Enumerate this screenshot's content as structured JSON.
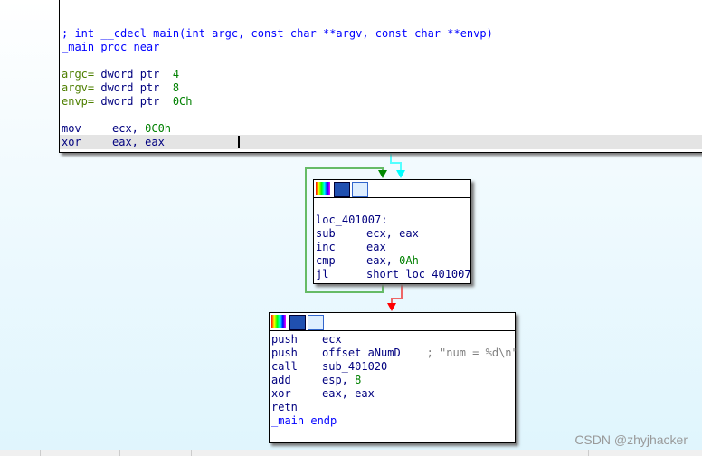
{
  "top_block": {
    "signature": "; int __cdecl main(int argc, const char **argv, const char **envp)",
    "proc": "_main proc near",
    "args": [
      {
        "name": "argc=",
        "type": " dword ptr  ",
        "val": "4"
      },
      {
        "name": "argv=",
        "type": " dword ptr  ",
        "val": "8"
      },
      {
        "name": "envp=",
        "type": " dword ptr  ",
        "val": "0Ch"
      }
    ],
    "ins": [
      {
        "op": "mov",
        "a": "ecx, ",
        "imm": "0C0h"
      },
      {
        "op": "xor",
        "a": "eax, eax",
        "imm": ""
      }
    ]
  },
  "loop_block": {
    "label": "loc_401007:",
    "ins": [
      {
        "op": "sub",
        "a": "ecx, eax",
        "imm": ""
      },
      {
        "op": "inc",
        "a": "eax",
        "imm": ""
      },
      {
        "op": "cmp",
        "a": "eax, ",
        "imm": "0Ah"
      },
      {
        "op": "jl",
        "a": "short loc_401007",
        "imm": ""
      }
    ]
  },
  "end_block": {
    "ins": [
      {
        "op": "push",
        "a": "ecx"
      },
      {
        "op": "push",
        "a": "offset aNumD    ",
        "cm": "; \"num = %d\\n\""
      },
      {
        "op": "call",
        "a": "sub_401020"
      },
      {
        "op": "add",
        "a": "esp, ",
        "imm": "8"
      },
      {
        "op": "xor",
        "a": "eax, eax"
      },
      {
        "op": "retn",
        "a": ""
      }
    ],
    "endp": "_main endp"
  },
  "edge_colors": {
    "flow": "#00ffff",
    "taken": "#008000",
    "not_taken": "#ff0000"
  },
  "watermark": "CSDN @zhyjhacker"
}
